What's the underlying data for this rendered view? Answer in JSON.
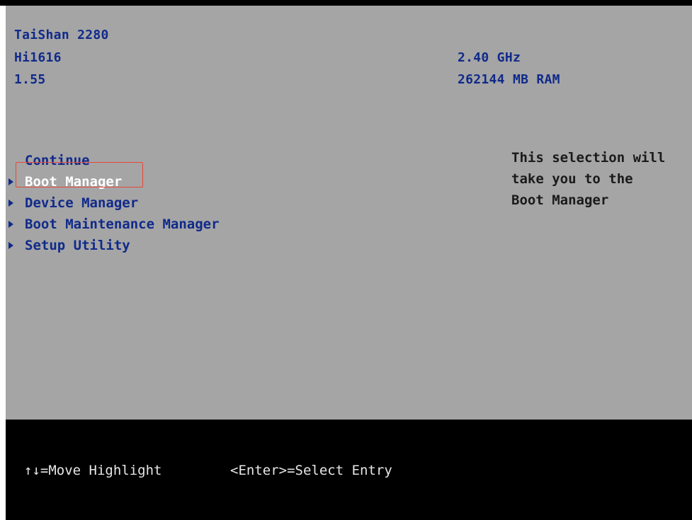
{
  "system_info": {
    "model": "TaiShan 2280",
    "cpu": "Hi1616",
    "version": "1.55",
    "cpu_speed": "2.40 GHz",
    "memory": "262144 MB RAM"
  },
  "menu": {
    "items": [
      {
        "label": "Continue",
        "has_arrow": false,
        "selected": false
      },
      {
        "label": "Boot Manager",
        "has_arrow": true,
        "selected": true
      },
      {
        "label": "Device Manager",
        "has_arrow": true,
        "selected": false
      },
      {
        "label": "Boot Maintenance Manager",
        "has_arrow": true,
        "selected": false
      },
      {
        "label": "Setup Utility",
        "has_arrow": true,
        "selected": false
      }
    ]
  },
  "help": {
    "lines": [
      "This selection will",
      "take you to the",
      "Boot Manager"
    ]
  },
  "footer": {
    "hint_move": "↑↓=Move Highlight",
    "hint_select": "<Enter>=Select Entry"
  },
  "colors": {
    "panel_background": "#a5a5a5",
    "text_blue": "#102a8a",
    "footer_background": "#000000",
    "selection_outline": "#e8483a"
  }
}
